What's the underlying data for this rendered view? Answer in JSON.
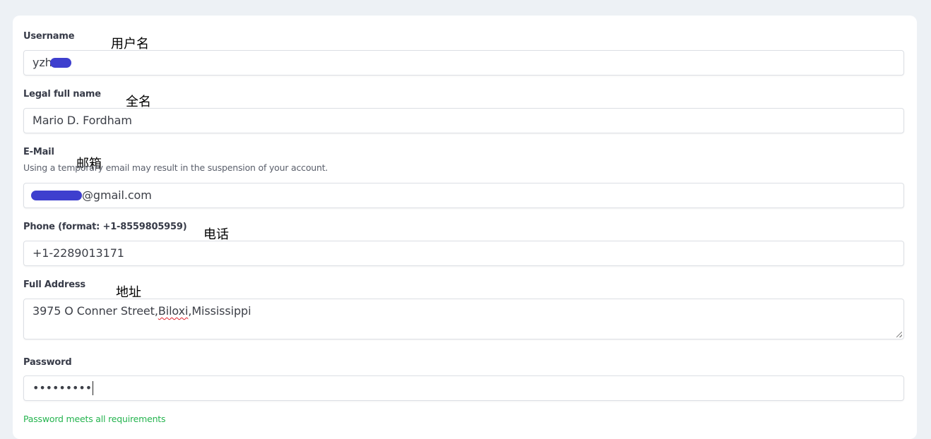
{
  "form": {
    "username": {
      "label": "Username",
      "annotation": "用户名",
      "value_visible": "yzh"
    },
    "full_name": {
      "label": "Legal full name",
      "annotation": "全名",
      "value": "Mario D. Fordham"
    },
    "email": {
      "label": "E-Mail",
      "annotation": "邮箱",
      "help": "Using a temporary email may result in the suspension of your account.",
      "value_visible": "@gmail.com"
    },
    "phone": {
      "label": "Phone (format: +1-8559805959)",
      "annotation": "电话",
      "value": "+1-2289013171"
    },
    "address": {
      "label": "Full Address",
      "annotation": "地址",
      "value_prefix": "3975 O Conner Street,",
      "value_misspelled": "Biloxi",
      "value_suffix": ",Mississippi"
    },
    "password": {
      "label": "Password",
      "masked_value": "•••••••••",
      "status": "Password meets all requirements"
    }
  },
  "colors": {
    "page_background": "#edf1f5",
    "card_background": "#ffffff",
    "redaction": "#3e3fce",
    "success": "#25b44f",
    "label": "#373b48"
  }
}
